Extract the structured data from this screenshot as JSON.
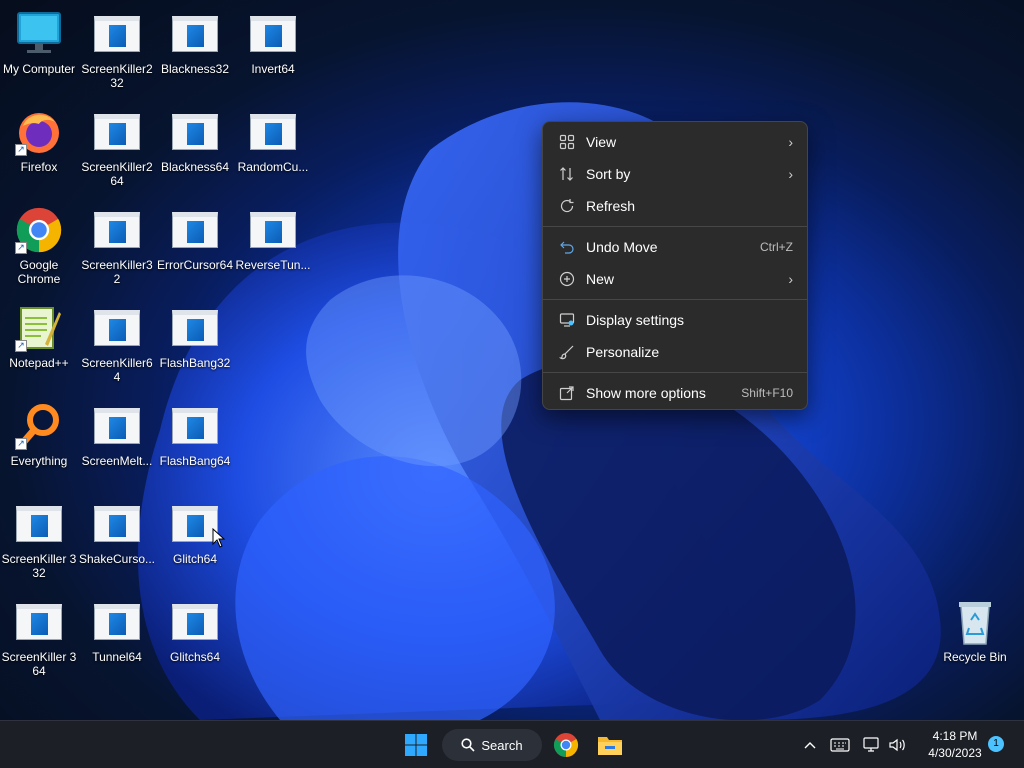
{
  "desktop": {
    "icons": [
      {
        "label": "My Computer",
        "icon": "monitor-icon"
      },
      {
        "label": "ScreenKiller2 32",
        "icon": "exe-icon"
      },
      {
        "label": "Blackness32",
        "icon": "exe-icon"
      },
      {
        "label": "Invert64",
        "icon": "exe-icon"
      },
      {
        "label": "Firefox",
        "icon": "firefox-icon"
      },
      {
        "label": "ScreenKiller2 64",
        "icon": "exe-icon"
      },
      {
        "label": "Blackness64",
        "icon": "exe-icon"
      },
      {
        "label": "RandomCu...",
        "icon": "exe-icon"
      },
      {
        "label": "Google Chrome",
        "icon": "chrome-icon"
      },
      {
        "label": "ScreenKiller32",
        "icon": "exe-icon"
      },
      {
        "label": "ErrorCursor64",
        "icon": "exe-icon"
      },
      {
        "label": "ReverseTun...",
        "icon": "exe-icon"
      },
      {
        "label": "Notepad++",
        "icon": "notepad-plus-plus-icon"
      },
      {
        "label": "ScreenKiller64",
        "icon": "exe-icon"
      },
      {
        "label": "FlashBang32",
        "icon": "exe-icon"
      },
      {
        "label": "Everything",
        "icon": "everything-search-icon"
      },
      {
        "label": "ScreenMelt...",
        "icon": "exe-icon"
      },
      {
        "label": "FlashBang64",
        "icon": "exe-icon"
      },
      {
        "label": "ScreenKiller 3 32",
        "icon": "exe-icon"
      },
      {
        "label": "ShakeCurso...",
        "icon": "exe-icon"
      },
      {
        "label": "Glitch64",
        "icon": "exe-icon"
      },
      {
        "label": "ScreenKiller 3 64",
        "icon": "exe-icon"
      },
      {
        "label": "Tunnel64",
        "icon": "exe-icon"
      },
      {
        "label": "Glitchs64",
        "icon": "exe-icon"
      },
      {
        "label": "Recycle Bin",
        "icon": "recycle-bin-icon"
      }
    ]
  },
  "context_menu": {
    "items": [
      {
        "label": "View",
        "icon": "grid-view-icon",
        "submenu": true
      },
      {
        "label": "Sort by",
        "icon": "sort-icon",
        "submenu": true
      },
      {
        "label": "Refresh",
        "icon": "refresh-icon"
      },
      {
        "label": "Undo Move",
        "icon": "undo-icon",
        "shortcut": "Ctrl+Z"
      },
      {
        "label": "New",
        "icon": "plus-circle-icon",
        "submenu": true
      },
      {
        "label": "Display settings",
        "icon": "display-settings-icon"
      },
      {
        "label": "Personalize",
        "icon": "brush-icon"
      },
      {
        "label": "Show more options",
        "icon": "share-out-icon",
        "shortcut": "Shift+F10"
      }
    ]
  },
  "taskbar": {
    "search_label": "Search",
    "time": "4:18 PM",
    "date": "4/30/2023",
    "notification_count": "1"
  },
  "colors": {
    "accent": "#4cc2ff",
    "menu_bg": "#2b2b2b",
    "taskbar_bg": "#1c1f26"
  }
}
